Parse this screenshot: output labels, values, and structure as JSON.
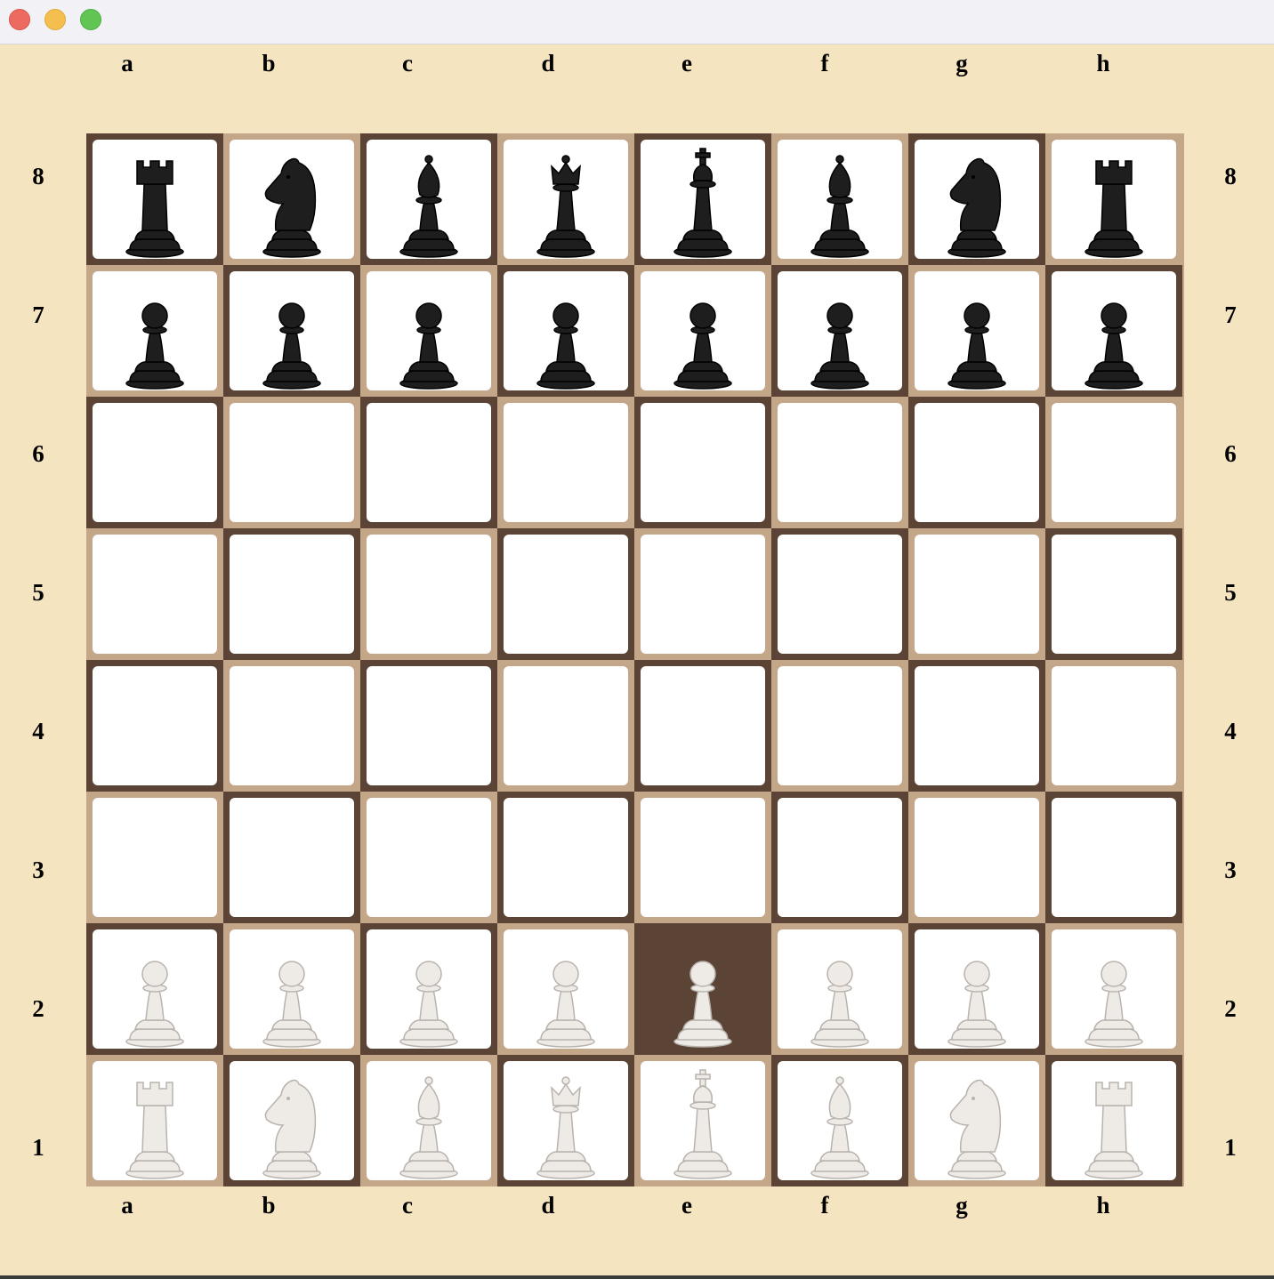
{
  "window": {
    "controls": [
      "close",
      "minimize",
      "maximize"
    ]
  },
  "board": {
    "files": [
      "a",
      "b",
      "c",
      "d",
      "e",
      "f",
      "g",
      "h"
    ],
    "ranks": [
      "8",
      "7",
      "6",
      "5",
      "4",
      "3",
      "2",
      "1"
    ],
    "selected_square": "e2",
    "colors": {
      "dark_square": "#5b4436",
      "light_square": "#c4a789",
      "cell": "#ffffff",
      "background": "#f5e4c0",
      "black_piece": "#1e1e1e",
      "white_piece": "#eeeae6"
    },
    "position": [
      [
        "br",
        "bn",
        "bb",
        "bq",
        "bk",
        "bb",
        "bn",
        "br"
      ],
      [
        "bp",
        "bp",
        "bp",
        "bp",
        "bp",
        "bp",
        "bp",
        "bp"
      ],
      [
        "",
        "",
        "",
        "",
        "",
        "",
        "",
        ""
      ],
      [
        "",
        "",
        "",
        "",
        "",
        "",
        "",
        ""
      ],
      [
        "",
        "",
        "",
        "",
        "",
        "",
        "",
        ""
      ],
      [
        "",
        "",
        "",
        "",
        "",
        "",
        "",
        ""
      ],
      [
        "wp",
        "wp",
        "wp",
        "wp",
        "wp",
        "wp",
        "wp",
        "wp"
      ],
      [
        "wr",
        "wn",
        "wb",
        "wq",
        "wk",
        "wb",
        "wn",
        "wr"
      ]
    ]
  },
  "piece_names": {
    "p": "pawn",
    "r": "rook",
    "n": "knight",
    "b": "bishop",
    "q": "queen",
    "k": "king"
  }
}
